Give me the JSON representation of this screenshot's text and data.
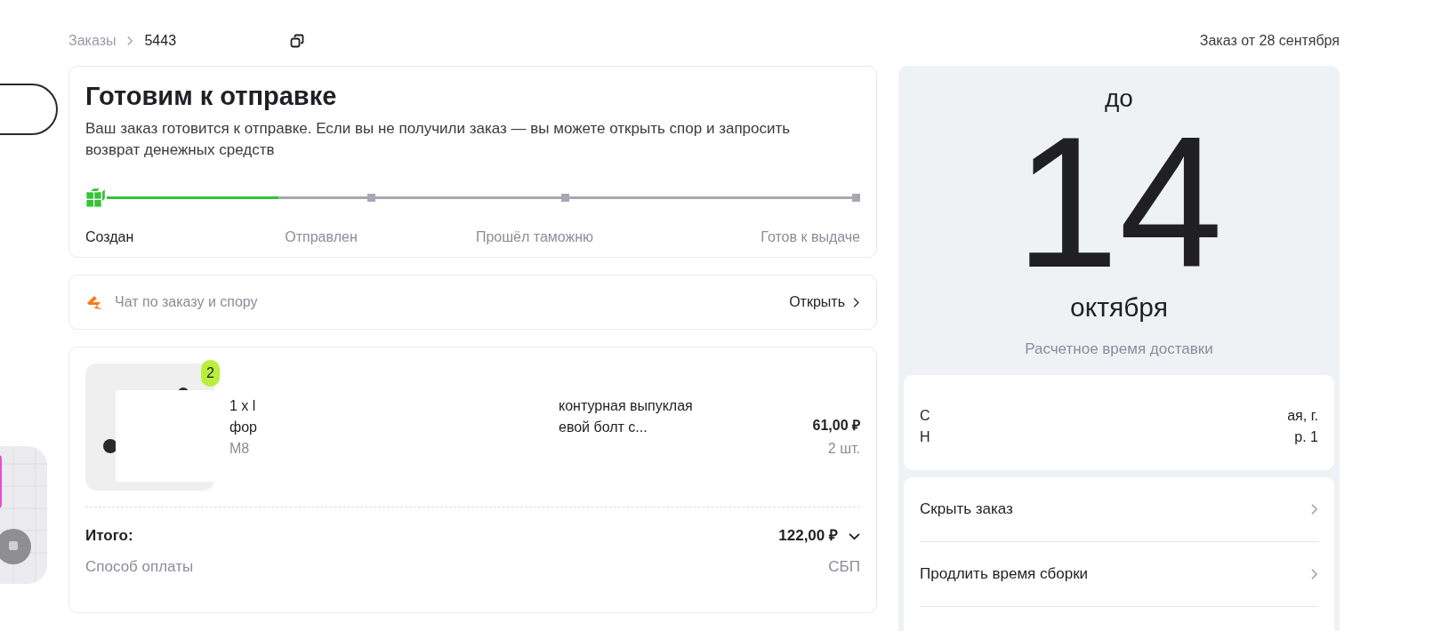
{
  "breadcrumb": {
    "parent": "Заказы",
    "current": "5443"
  },
  "order_date": "Заказ от 28 сентября",
  "status": {
    "title": "Готовим к отправке",
    "description": "Ваш заказ готовится к отправке. Если вы не получили заказ — вы можете открыть спор и запросить возврат денежных средств",
    "level": 0.66,
    "stages": [
      {
        "label": "Создан",
        "reached": true
      },
      {
        "label": "Отправлен",
        "reached": false
      },
      {
        "label": "Прошёл таможню",
        "reached": false
      },
      {
        "label": "Готов к выдаче",
        "reached": false
      }
    ]
  },
  "chat": {
    "label": "Чат по заказу и спору",
    "action": "Открыть"
  },
  "product": {
    "badge": "2",
    "title_left": [
      "1 x l",
      "фор"
    ],
    "title_right": [
      "контурная выпуклая",
      "евой болт с..."
    ],
    "variant": "M8",
    "price": "61,00 ₽",
    "quantity": "2 шт."
  },
  "total": {
    "label": "Итого:",
    "value": "122,00 ₽",
    "expanded": false
  },
  "payment": {
    "label": "Способ оплаты",
    "value": "СБП"
  },
  "delivery": {
    "prefix": "до",
    "day": "14",
    "month": "октября",
    "caption": "Расчетное время доставки"
  },
  "address": {
    "left": [
      "С",
      "Н"
    ],
    "right": [
      "ая, г.",
      "р. 1"
    ]
  },
  "actions": [
    "Скрыть заказ",
    "Продлить время сборки"
  ]
}
